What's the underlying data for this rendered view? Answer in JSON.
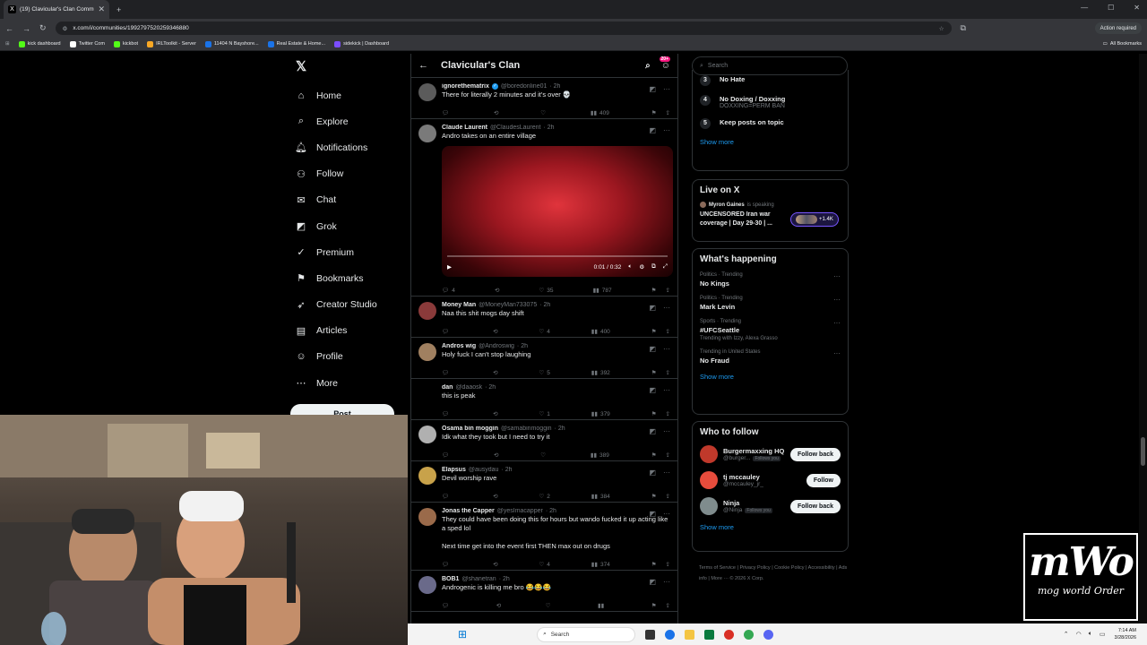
{
  "browser": {
    "tab_title": "(19) Clavicular's Clan Communi",
    "url": "x.com/i/communities/1992797520259346880",
    "action_required": "Action required",
    "bookmarks": [
      {
        "label": "kick dashboard",
        "color": "#53fc18"
      },
      {
        "label": "Twitter Com",
        "color": "#ffffff"
      },
      {
        "label": "kickbot",
        "color": "#53fc18"
      },
      {
        "label": "IRLToolkit - Server",
        "color": "#f9a825"
      },
      {
        "label": "11404 N Bayshore...",
        "color": "#1a73e8"
      },
      {
        "label": "Real Estate & Home...",
        "color": "#1a73e8"
      },
      {
        "label": "sidekick | Dashboard",
        "color": "#7b4dff"
      }
    ],
    "all_bookmarks": "All Bookmarks"
  },
  "nav": {
    "items": [
      {
        "label": "Home",
        "icon": "⌂",
        "icon_name": "home-icon"
      },
      {
        "label": "Explore",
        "icon": "⌕",
        "icon_name": "search-icon"
      },
      {
        "label": "Notifications",
        "icon": "🔔︎",
        "icon_name": "bell-icon"
      },
      {
        "label": "Follow",
        "icon": "⚇",
        "icon_name": "person-add-icon"
      },
      {
        "label": "Chat",
        "icon": "✉",
        "icon_name": "mail-icon"
      },
      {
        "label": "Grok",
        "icon": "◩",
        "icon_name": "grok-icon"
      },
      {
        "label": "Premium",
        "icon": "✓",
        "icon_name": "premium-icon"
      },
      {
        "label": "Bookmarks",
        "icon": "⚑",
        "icon_name": "bookmark-icon"
      },
      {
        "label": "Creator Studio",
        "icon": "➶",
        "icon_name": "rocket-icon"
      },
      {
        "label": "Articles",
        "icon": "▤",
        "icon_name": "articles-icon"
      },
      {
        "label": "Profile",
        "icon": "☺",
        "icon_name": "profile-icon"
      },
      {
        "label": "More",
        "icon": "⋯",
        "icon_name": "more-icon"
      }
    ],
    "post_label": "Post"
  },
  "feed": {
    "title": "Clavicular's Clan",
    "badge": "20+",
    "posts": [
      {
        "name": "ignorethematrix",
        "verified": true,
        "handle": "@boredonline01",
        "time": "· 2h",
        "text": "There for literally 2 minutes and it's over 💀",
        "replies": "",
        "likes": "",
        "views": "409",
        "avatar": "#5b5b5b"
      },
      {
        "name": "Claude Laurent",
        "verified": false,
        "handle": "@ClaudesLaurent",
        "time": "· 2h",
        "text": "Andro takes on an entire village",
        "replies": "4",
        "likes": "35",
        "views": "787",
        "avatar": "#7a7a7a"
      },
      {
        "name": "Money Man",
        "verified": false,
        "handle": "@MoneyMan733075",
        "time": "· 2h",
        "text": "Naa this shit  mogs day shift",
        "replies": "",
        "likes": "4",
        "views": "400",
        "avatar": "#8a3a3a"
      },
      {
        "name": "Andros wig",
        "verified": false,
        "handle": "@Androswig",
        "time": "· 2h",
        "text": "Holy fuck I can't stop laughing",
        "replies": "",
        "likes": "5",
        "views": "392",
        "avatar": "#a08060"
      },
      {
        "name": "dan",
        "verified": false,
        "handle": "@daaosk",
        "time": "· 2h",
        "text": "this is peak",
        "replies": "",
        "likes": "1",
        "views": "379",
        "avatar": "#000000"
      },
      {
        "name": "Osama bin moggin",
        "verified": false,
        "handle": "@samabinmoggin",
        "time": "· 2h",
        "text": "Idk what they took but I need to try it",
        "replies": "",
        "likes": "",
        "views": "389",
        "avatar": "#b0b0b0"
      },
      {
        "name": "Elapsus",
        "verified": false,
        "handle": "@ausydau",
        "time": "· 2h",
        "text": "Devil worship rave",
        "replies": "",
        "likes": "2",
        "views": "384",
        "avatar": "#c8a24a"
      },
      {
        "name": "Jonas the Capper",
        "verified": false,
        "handle": "@yesImacapper",
        "time": "· 2h",
        "text": "They could have been doing this for hours but wando fucked it up acting like a sped lol",
        "text2": "Next time get into the event first THEN max out on drugs",
        "replies": "",
        "likes": "4",
        "views": "374",
        "avatar": "#9a6a4a"
      },
      {
        "name": "BOB1",
        "verified": false,
        "handle": "@shanetran",
        "time": "· 2h",
        "text": "Androgenic is killing me bro 😂😂😂",
        "replies": "",
        "likes": "",
        "views": "",
        "avatar": "#6a6a8a"
      }
    ],
    "video_time": "0:01 / 0:32"
  },
  "right": {
    "search_placeholder": "Search",
    "rules": [
      {
        "num": "3",
        "title": "No Hate",
        "sub": ""
      },
      {
        "num": "4",
        "title": "No Doxing / Doxxing",
        "sub": "DOXXING=PERM BAN"
      },
      {
        "num": "5",
        "title": "Keep posts on topic",
        "sub": ""
      }
    ],
    "show_more": "Show more",
    "live": {
      "title": "Live on X",
      "host": "Myron Gaines",
      "speaking": "is speaking",
      "text": "UNCENSORED Iran war coverage | Day 29-30 | ...",
      "count": "+1.4K"
    },
    "happening_title": "What's happening",
    "trends": [
      {
        "cat": "Politics · Trending",
        "name": "No Kings",
        "with": ""
      },
      {
        "cat": "Politics · Trending",
        "name": "Mark Levin",
        "with": ""
      },
      {
        "cat": "Sports · Trending",
        "name": "#UFCSeattle",
        "with": "Trending with Izzy, Alexa Grasso"
      },
      {
        "cat": "Trending in United States",
        "name": "No Fraud",
        "with": ""
      }
    ],
    "who_title": "Who to follow",
    "follows": [
      {
        "name": "Burgermaxxing HQ",
        "handle": "@burger...",
        "follows_you": "Follows you",
        "button": "Follow back",
        "avatar": "#c0392b"
      },
      {
        "name": "tj mccauley",
        "handle": "@mccauley_jr_",
        "follows_you": "",
        "button": "Follow",
        "avatar": "#e74c3c"
      },
      {
        "name": "Ninja",
        "handle": "@Ninja",
        "follows_you": "Follows you",
        "button": "Follow back",
        "avatar": "#7f8c8d"
      }
    ],
    "footer": "Terms of Service  |  Privacy Policy  |  Cookie Policy  |  Accessibility  |  Ads info  |  More ···  © 2026 X Corp."
  },
  "overlay": {
    "logo_big": "mWo",
    "logo_small": "mog world Order"
  },
  "taskbar": {
    "search": "Search",
    "time": "7:14 AM",
    "date": "3/28/2026"
  }
}
